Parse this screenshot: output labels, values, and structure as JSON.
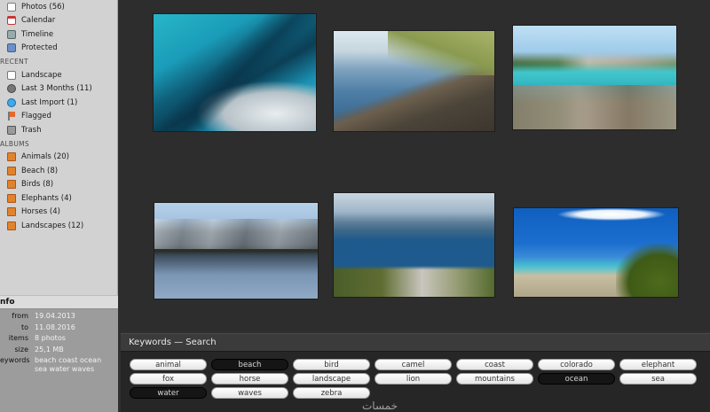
{
  "sidebar": {
    "library": [
      {
        "label": "Photos (56)",
        "icon": "photos-icon"
      },
      {
        "label": "Calendar",
        "icon": "calendar-icon"
      },
      {
        "label": "Timeline",
        "icon": "timeline-icon"
      },
      {
        "label": "Protected",
        "icon": "protected-icon"
      }
    ],
    "recent_header": "RECENT",
    "recent": [
      {
        "label": "Landscape",
        "icon": "landscape-icon"
      },
      {
        "label": "Last 3 Months (11)",
        "icon": "clock-icon"
      },
      {
        "label": "Last Import (1)",
        "icon": "import-icon"
      },
      {
        "label": "Flagged",
        "icon": "flag-icon"
      },
      {
        "label": "Trash",
        "icon": "trash-icon"
      }
    ],
    "albums_header": "ALBUMS",
    "albums": [
      {
        "label": "Animals (20)",
        "icon": "folder-icon"
      },
      {
        "label": "Beach (8)",
        "icon": "folder-icon"
      },
      {
        "label": "Birds (8)",
        "icon": "folder-icon"
      },
      {
        "label": "Elephants (4)",
        "icon": "folder-icon"
      },
      {
        "label": "Horses (4)",
        "icon": "folder-icon"
      },
      {
        "label": "Landscapes (12)",
        "icon": "folder-icon"
      }
    ]
  },
  "info": {
    "header": "nfo",
    "rows": [
      {
        "key": "from",
        "value": "19.04.2013"
      },
      {
        "key": "to",
        "value": "11.08.2016"
      },
      {
        "key": "items",
        "value": "8 photos"
      },
      {
        "key": "size",
        "value": "25,1 MB"
      },
      {
        "key": "eywords",
        "value": "beach coast ocean sea water waves"
      }
    ]
  },
  "keywords": {
    "header": "Keywords — Search",
    "pills": [
      {
        "label": "animal",
        "selected": false
      },
      {
        "label": "beach",
        "selected": true
      },
      {
        "label": "bird",
        "selected": false
      },
      {
        "label": "camel",
        "selected": false
      },
      {
        "label": "coast",
        "selected": false
      },
      {
        "label": "colorado",
        "selected": false
      },
      {
        "label": "elephant",
        "selected": false
      },
      {
        "label": "fox",
        "selected": false
      },
      {
        "label": "horse",
        "selected": false
      },
      {
        "label": "landscape",
        "selected": false
      },
      {
        "label": "lion",
        "selected": false
      },
      {
        "label": "mountains",
        "selected": false
      },
      {
        "label": "ocean",
        "selected": true
      },
      {
        "label": "sea",
        "selected": false
      },
      {
        "label": "water",
        "selected": true
      },
      {
        "label": "waves",
        "selected": false
      },
      {
        "label": "zebra",
        "selected": false
      }
    ]
  },
  "watermark": "خمسات",
  "colors": {
    "sidebar_bg": "#d2d2d2",
    "main_bg": "#2d2d2d",
    "keyword_selected": "#151515",
    "folder": "#e0832c"
  }
}
